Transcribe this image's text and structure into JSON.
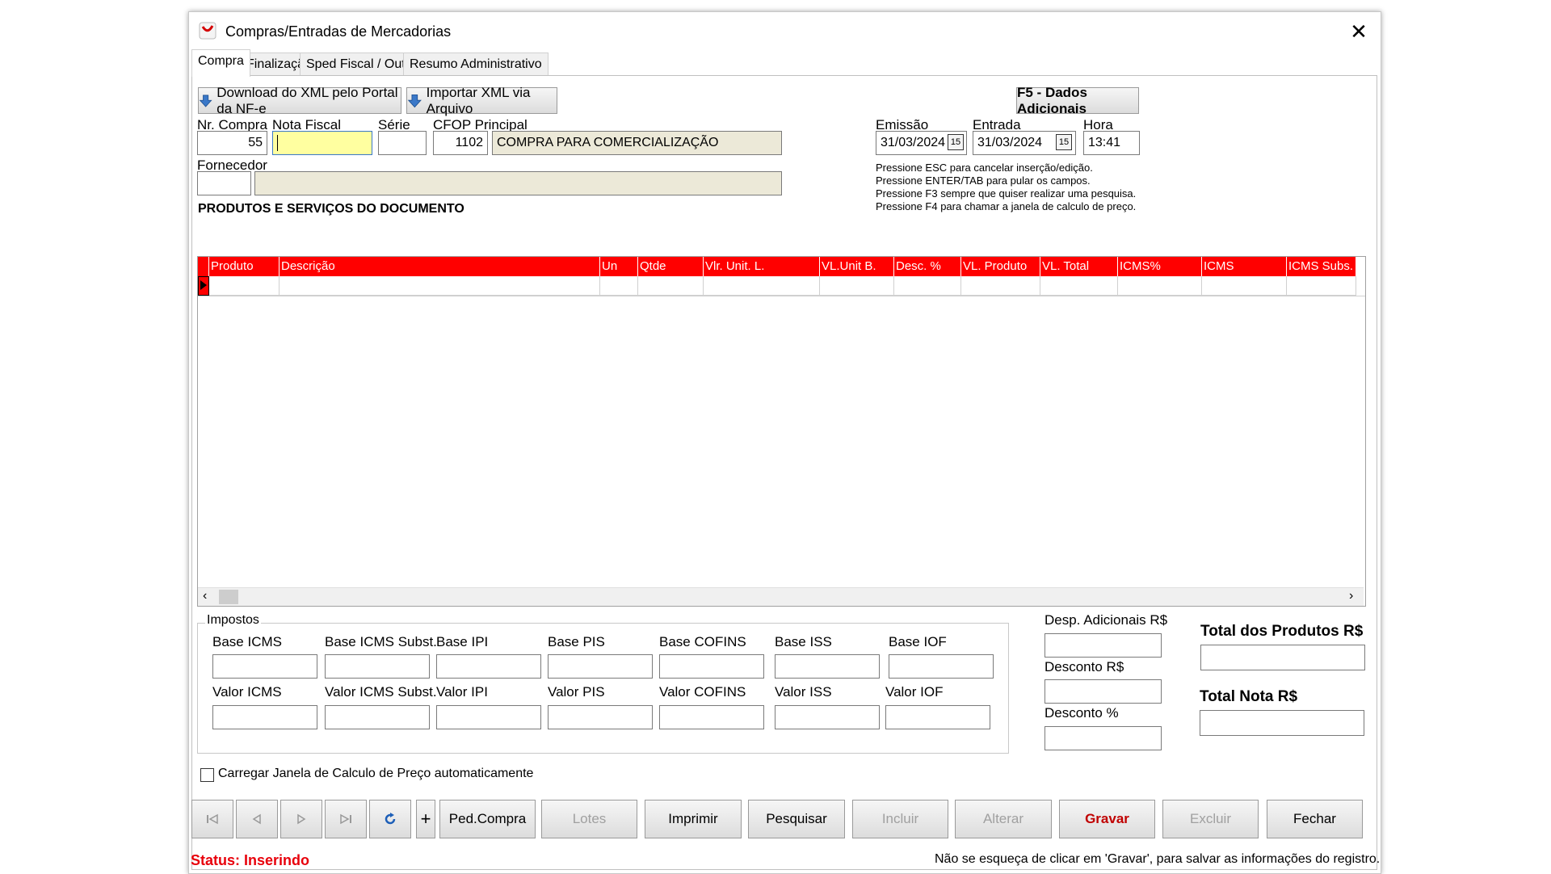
{
  "window": {
    "title": "Compras/Entradas de Mercadorias"
  },
  "tabs": [
    "Compra",
    "Finalização",
    "Sped Fiscal / Outros",
    "Resumo Administrativo"
  ],
  "toolbar": {
    "download_xml": "Download do XML pelo Portal da NF-e",
    "import_xml": "Importar XML via Arquivo",
    "dados_adicionais": "F5 - Dados Adicionais"
  },
  "form": {
    "nr_compra_label": "Nr. Compra",
    "nr_compra_value": "55",
    "nota_fiscal_label": "Nota Fiscal",
    "nota_fiscal_value": "",
    "serie_label": "Série",
    "serie_value": "",
    "cfop_label": "CFOP Principal",
    "cfop_code": "1102",
    "cfop_desc": "COMPRA PARA COMERCIALIZAÇÃO",
    "fornecedor_label": "Fornecedor",
    "fornecedor_code": "",
    "fornecedor_name": "",
    "emissao_label": "Emissão",
    "emissao_value": "31/03/2024",
    "entrada_label": "Entrada",
    "entrada_value": "31/03/2024",
    "hora_label": "Hora",
    "hora_value": "13:41"
  },
  "hints": [
    "Pressione ESC para cancelar inserção/edição.",
    "Pressione ENTER/TAB para pular os campos.",
    "Pressione F3 sempre que quiser realizar uma pesquisa.",
    "Pressione F4 para chamar a janela de calculo de preço."
  ],
  "products": {
    "section_title": "PRODUTOS E SERVIÇOS DO  DOCUMENTO",
    "columns": [
      "Produto",
      "Descrição",
      "Un",
      "Qtde",
      "Vlr. Unit. L.",
      "VL.Unit B.",
      "Desc. %",
      "VL. Produto",
      "VL. Total",
      "ICMS%",
      "ICMS",
      "ICMS Subs."
    ],
    "rows": []
  },
  "impostos": {
    "group_label": "Impostos",
    "row1": [
      "Base ICMS",
      "Base ICMS Subst.",
      "Base IPI",
      "Base PIS",
      "Base COFINS",
      "Base ISS",
      "Base IOF"
    ],
    "row2": [
      "Valor ICMS",
      "Valor ICMS Subst.",
      "Valor IPI",
      "Valor PIS",
      "Valor COFINS",
      "Valor ISS",
      "Valor IOF"
    ]
  },
  "totals": {
    "desp_adicionais": "Desp. Adicionais R$",
    "desconto": "Desconto R$",
    "desconto_pct": "Desconto %",
    "total_produtos": "Total dos Produtos R$",
    "total_nota": "Total Nota R$"
  },
  "checkbox": {
    "label": "Carregar Janela de Calculo de Preço automaticamente",
    "checked": false
  },
  "bottom_buttons": {
    "ped_compra": "Ped.Compra",
    "lotes": "Lotes",
    "imprimir": "Imprimir",
    "pesquisar": "Pesquisar",
    "incluir": "Incluir",
    "alterar": "Alterar",
    "gravar": "Gravar",
    "excluir": "Excluir",
    "fechar": "Fechar",
    "plus": "+"
  },
  "status": {
    "text": "Status:  Inserindo",
    "note": "Não se esqueça de clicar em 'Gravar', para salvar  as informações do registro."
  },
  "colors": {
    "grid_header": "#ff0000",
    "status": "#e8000b",
    "gravar": "#c00000",
    "readonly_bg": "#ece9d8",
    "active_input_bg": "#ffffa0"
  }
}
